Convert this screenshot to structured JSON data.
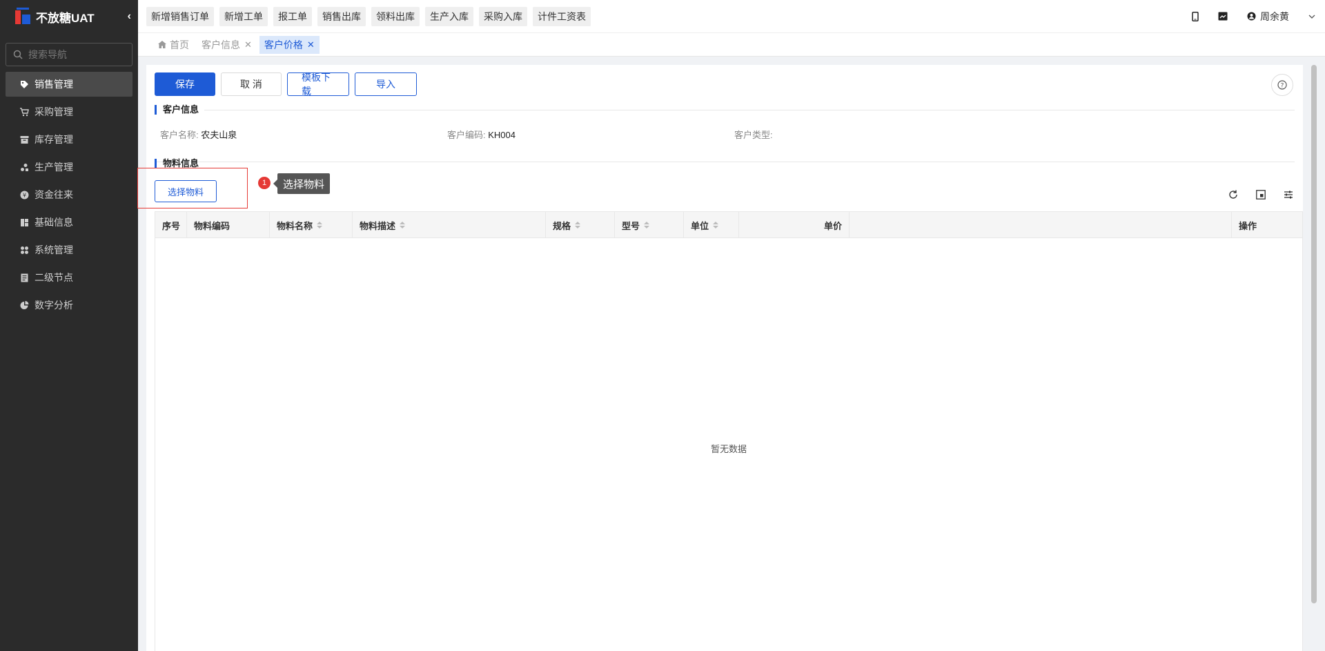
{
  "app": {
    "brand": "不放糖UAT"
  },
  "sidebar": {
    "search_placeholder": "搜索导航",
    "items": [
      {
        "label": "销售管理",
        "icon": "tag-icon"
      },
      {
        "label": "采购管理",
        "icon": "cart-icon"
      },
      {
        "label": "库存管理",
        "icon": "box-icon"
      },
      {
        "label": "生产管理",
        "icon": "production-icon"
      },
      {
        "label": "资金往来",
        "icon": "money-icon"
      },
      {
        "label": "基础信息",
        "icon": "grid-icon"
      },
      {
        "label": "系统管理",
        "icon": "apps-icon"
      },
      {
        "label": "二级节点",
        "icon": "doc-icon"
      },
      {
        "label": "数字分析",
        "icon": "pie-icon"
      }
    ]
  },
  "header": {
    "quick_links": [
      "新增销售订单",
      "新增工单",
      "报工单",
      "销售出库",
      "领料出库",
      "生产入库",
      "采购入库",
      "计件工资表"
    ],
    "user_name": "周余黄"
  },
  "tabs": {
    "home": "首页",
    "items": [
      {
        "label": "客户信息",
        "active": false
      },
      {
        "label": "客户价格",
        "active": true
      }
    ]
  },
  "toolbar": {
    "save": "保存",
    "cancel": "取 消",
    "template": "模板下载",
    "import": "导入"
  },
  "customer": {
    "section_title": "客户信息",
    "name_label": "客户名称:",
    "name_value": "农夫山泉",
    "code_label": "客户编码:",
    "code_value": "KH004",
    "type_label": "客户类型:",
    "type_value": ""
  },
  "material": {
    "section_title": "物料信息",
    "select_button": "选择物料",
    "tooltip_step": "1",
    "tooltip_text": "选择物料",
    "columns": [
      "序号",
      "物料编码",
      "物料名称",
      "物料描述",
      "规格",
      "型号",
      "单位",
      "单价",
      "操作"
    ],
    "empty_text": "暂无数据"
  },
  "colors": {
    "primary": "#1e5bd6",
    "sidebar_bg": "#2b2b2b",
    "highlight": "#e53935"
  }
}
